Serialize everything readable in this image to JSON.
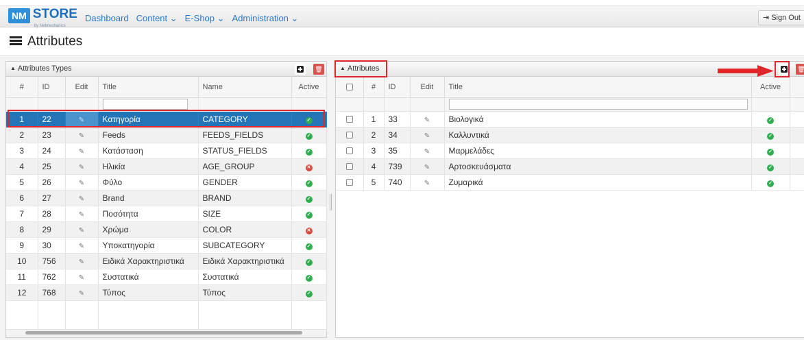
{
  "topbar": {
    "logo_nm": "NM",
    "logo_store": "STORE",
    "logo_by": "by Netmechanics",
    "nav": [
      {
        "label": "Dashboard"
      },
      {
        "label": "Content ⌄"
      },
      {
        "label": "E-Shop ⌄"
      },
      {
        "label": "Administration ⌄"
      }
    ],
    "signout_label": "Sign Out"
  },
  "page": {
    "title": "Attributes",
    "icon": "list-icon"
  },
  "types_panel": {
    "title": "Attributes Types",
    "columns": [
      "#",
      "ID",
      "Edit",
      "Title",
      "Name",
      "Active"
    ],
    "selected_row": 1,
    "rows": [
      {
        "n": "1",
        "id": "22",
        "title": "Κατηγορία",
        "name": "CATEGORY",
        "active": true
      },
      {
        "n": "2",
        "id": "23",
        "title": "Feeds",
        "name": "FEEDS_FIELDS",
        "active": true
      },
      {
        "n": "3",
        "id": "24",
        "title": "Κατάσταση",
        "name": "STATUS_FIELDS",
        "active": true
      },
      {
        "n": "4",
        "id": "25",
        "title": "Ηλικία",
        "name": "AGE_GROUP",
        "active": false
      },
      {
        "n": "5",
        "id": "26",
        "title": "Φύλο",
        "name": "GENDER",
        "active": true
      },
      {
        "n": "6",
        "id": "27",
        "title": "Brand",
        "name": "BRAND",
        "active": true
      },
      {
        "n": "7",
        "id": "28",
        "title": "Ποσότητα",
        "name": "SIZE",
        "active": true
      },
      {
        "n": "8",
        "id": "29",
        "title": "Χρώμα",
        "name": "COLOR",
        "active": false
      },
      {
        "n": "9",
        "id": "30",
        "title": "Υποκατηγορία",
        "name": "SUBCATEGORY",
        "active": true
      },
      {
        "n": "10",
        "id": "756",
        "title": "Ειδικά Χαρακτηριστικά",
        "name": "Ειδικά Χαρακτηριστικά",
        "active": true
      },
      {
        "n": "11",
        "id": "762",
        "title": "Συστατικά",
        "name": "Συστατικά",
        "active": true
      },
      {
        "n": "12",
        "id": "768",
        "title": "Τύπος",
        "name": "Τύπος",
        "active": true
      }
    ]
  },
  "attributes_panel": {
    "title": "Attributes",
    "columns": [
      "",
      "#",
      "ID",
      "Edit",
      "Title",
      "Active"
    ],
    "rows": [
      {
        "n": "1",
        "id": "33",
        "title": "Βιολογικά",
        "active": true
      },
      {
        "n": "2",
        "id": "34",
        "title": "Καλλυντικά",
        "active": true
      },
      {
        "n": "3",
        "id": "35",
        "title": "Μαρμελάδες",
        "active": true
      },
      {
        "n": "4",
        "id": "739",
        "title": "Αρτοσκευάσματα",
        "active": true
      },
      {
        "n": "5",
        "id": "740",
        "title": "Ζυμαρικά",
        "active": true
      }
    ]
  },
  "colors": {
    "accent": "#2375b8",
    "highlight": "#e0262a",
    "active": "#2fae4e",
    "inactive": "#d94a3c"
  }
}
